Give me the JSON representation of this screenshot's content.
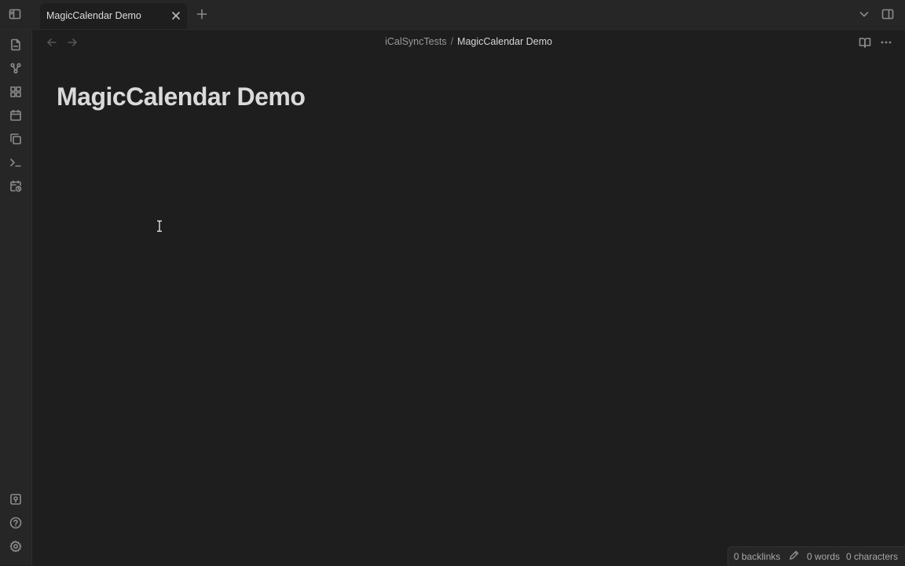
{
  "tab": {
    "title": "MagicCalendar Demo"
  },
  "breadcrumb": {
    "folder": "iCalSyncTests",
    "separator": "/",
    "file": "MagicCalendar Demo"
  },
  "note": {
    "title": "MagicCalendar Demo"
  },
  "ribbon": {
    "top_icons": [
      "file-icon",
      "graph-icon",
      "canvas-icon",
      "calendar-icon",
      "copy-icon",
      "terminal-icon",
      "calendar-clock-icon"
    ],
    "bottom_icons": [
      "vault-icon",
      "help-icon",
      "settings-icon"
    ]
  },
  "statusbar": {
    "backlinks": "0 backlinks",
    "words": "0 words",
    "characters": "0 characters"
  },
  "colors": {
    "background": "#1e1e1e",
    "chrome": "#262626",
    "text": "#dadada",
    "muted": "#8b8b8b"
  }
}
